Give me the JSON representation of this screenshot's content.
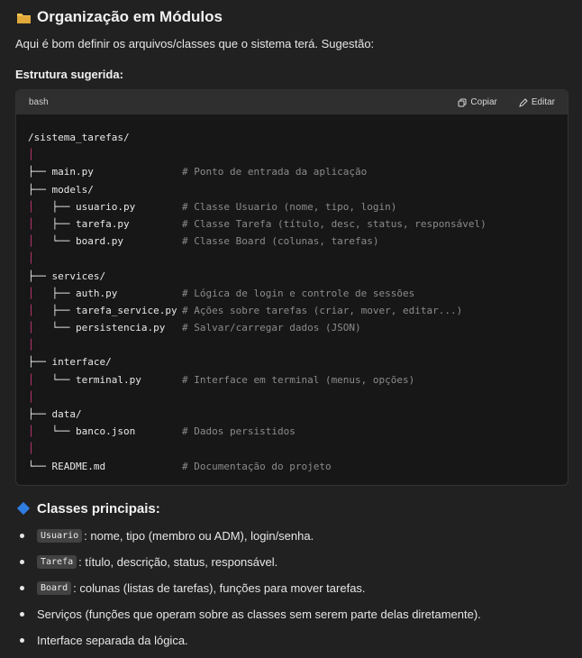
{
  "heading": "Organização em Módulos",
  "intro": "Aqui é bom definir os arquivos/classes que o sistema terá. Sugestão:",
  "subheading": "Estrutura sugerida:",
  "code_block": {
    "language": "bash",
    "copy_label": "Copiar",
    "edit_label": "Editar",
    "lines": [
      {
        "tree": "/sistema_tarefas/",
        "comment": ""
      },
      {
        "tree": "│",
        "comment": ""
      },
      {
        "tree": "├── main.py",
        "comment": "# Ponto de entrada da aplicação"
      },
      {
        "tree": "├── models/",
        "comment": ""
      },
      {
        "tree": "│   ├── usuario.py",
        "comment": "# Classe Usuario (nome, tipo, login)"
      },
      {
        "tree": "│   ├── tarefa.py",
        "comment": "# Classe Tarefa (título, desc, status, responsável)"
      },
      {
        "tree": "│   └── board.py",
        "comment": "# Classe Board (colunas, tarefas)"
      },
      {
        "tree": "│",
        "comment": ""
      },
      {
        "tree": "├── services/",
        "comment": ""
      },
      {
        "tree": "│   ├── auth.py",
        "comment": "# Lógica de login e controle de sessões"
      },
      {
        "tree": "│   ├── tarefa_service.py",
        "comment": "# Ações sobre tarefas (criar, mover, editar...)"
      },
      {
        "tree": "│   └── persistencia.py",
        "comment": "# Salvar/carregar dados (JSON)"
      },
      {
        "tree": "│",
        "comment": ""
      },
      {
        "tree": "├── interface/",
        "comment": ""
      },
      {
        "tree": "│   └── terminal.py",
        "comment": "# Interface em terminal (menus, opções)"
      },
      {
        "tree": "│",
        "comment": ""
      },
      {
        "tree": "├── data/",
        "comment": ""
      },
      {
        "tree": "│   └── banco.json",
        "comment": "# Dados persistidos"
      },
      {
        "tree": "│",
        "comment": ""
      },
      {
        "tree": "└── README.md",
        "comment": "# Documentação do projeto"
      }
    ]
  },
  "classes_heading": "Classes principais:",
  "bullets": [
    {
      "code": "Usuario",
      "text": ": nome, tipo (membro ou ADM), login/senha."
    },
    {
      "code": "Tarefa",
      "text": ": título, descrição, status, responsável."
    },
    {
      "code": "Board",
      "text": ": colunas (listas de tarefas), funções para mover tarefas."
    },
    {
      "code": "",
      "text": "Serviços (funções que operam sobre as classes sem serem parte delas diretamente)."
    },
    {
      "code": "",
      "text": "Interface separada da lógica."
    }
  ],
  "colors": {
    "accent_pipe": "#d13b7a",
    "comment": "#8b8b8b",
    "diamond": "#2f7de1",
    "folder": "#f2c14e"
  }
}
